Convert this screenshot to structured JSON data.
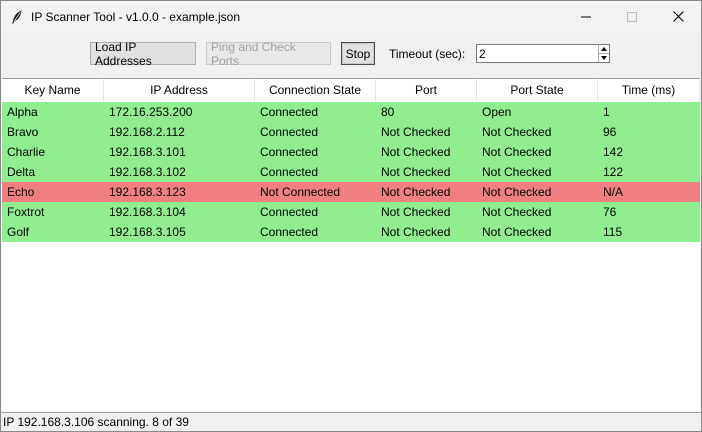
{
  "window": {
    "title": "IP Scanner Tool - v1.0.0 - example.json",
    "icon": "feather-icon"
  },
  "toolbar": {
    "load_label": "Load IP Addresses",
    "ping_label": "Ping and Check Ports",
    "stop_label": "Stop",
    "timeout_label": "Timeout (sec):",
    "timeout_value": "2"
  },
  "table": {
    "columns": [
      "Key Name",
      "IP Address",
      "Connection State",
      "Port",
      "Port State",
      "Time (ms)"
    ],
    "rows": [
      {
        "cells": [
          "Alpha",
          "172.16.253.200",
          "Connected",
          "80",
          "Open",
          "1"
        ],
        "status": "ok"
      },
      {
        "cells": [
          "Bravo",
          "192.168.2.112",
          "Connected",
          "Not Checked",
          "Not Checked",
          "96"
        ],
        "status": "ok"
      },
      {
        "cells": [
          "Charlie",
          "192.168.3.101",
          "Connected",
          "Not Checked",
          "Not Checked",
          "142"
        ],
        "status": "ok"
      },
      {
        "cells": [
          "Delta",
          "192.168.3.102",
          "Connected",
          "Not Checked",
          "Not Checked",
          "122"
        ],
        "status": "ok"
      },
      {
        "cells": [
          "Echo",
          "192.168.3.123",
          "Not Connected",
          "Not Checked",
          "Not Checked",
          "N/A"
        ],
        "status": "bad"
      },
      {
        "cells": [
          "Foxtrot",
          "192.168.3.104",
          "Connected",
          "Not Checked",
          "Not Checked",
          "76"
        ],
        "status": "ok"
      },
      {
        "cells": [
          "Golf",
          "192.168.3.105",
          "Connected",
          "Not Checked",
          "Not Checked",
          "115"
        ],
        "status": "ok"
      }
    ]
  },
  "status_bar": {
    "text": "IP 192.168.3.106 scanning. 8 of 39"
  },
  "colors": {
    "connected_row": "#90ee90",
    "not_connected_row": "#f08080"
  }
}
